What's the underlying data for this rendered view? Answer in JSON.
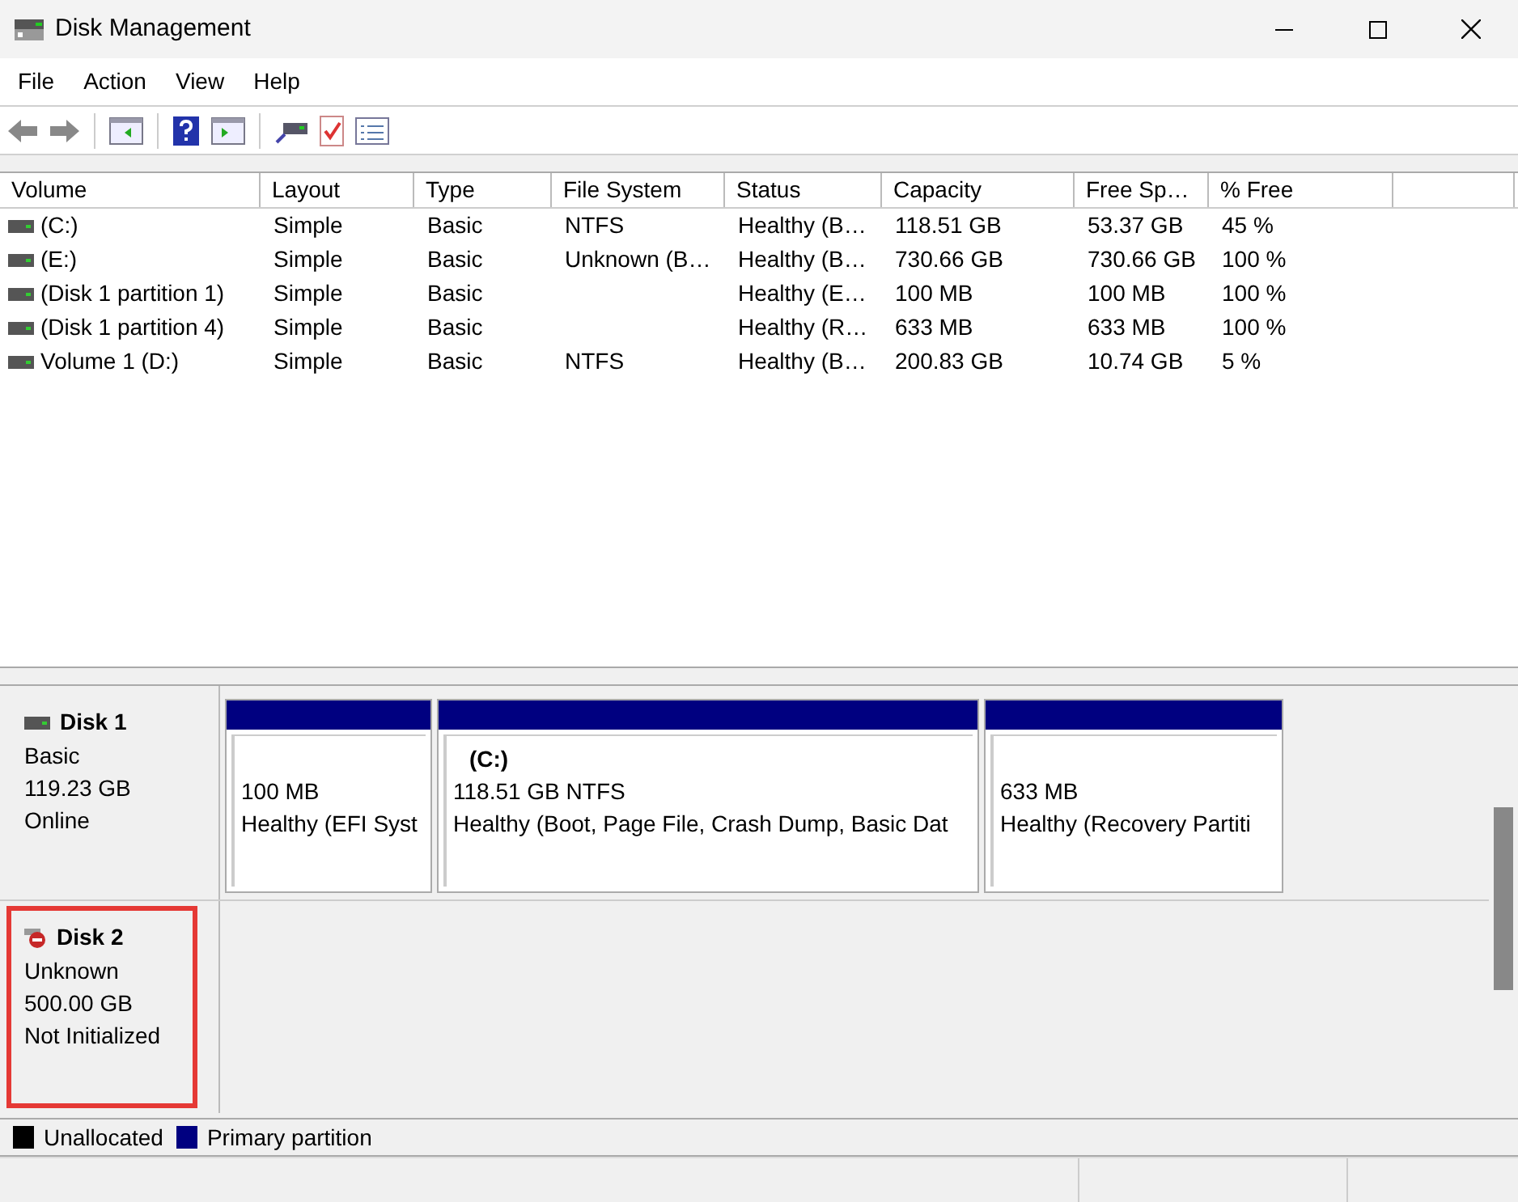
{
  "window": {
    "title": "Disk Management"
  },
  "menu": [
    "File",
    "Action",
    "View",
    "Help"
  ],
  "table": {
    "columns": [
      "Volume",
      "Layout",
      "Type",
      "File System",
      "Status",
      "Capacity",
      "Free Sp…",
      "% Free"
    ],
    "rows": [
      {
        "cells": [
          "(C:)",
          "Simple",
          "Basic",
          "NTFS",
          "Healthy (B…",
          "118.51 GB",
          "53.37 GB",
          "45 %"
        ]
      },
      {
        "cells": [
          "(E:)",
          "Simple",
          "Basic",
          "Unknown (B…",
          "Healthy (B…",
          "730.66 GB",
          "730.66 GB",
          "100 %"
        ]
      },
      {
        "cells": [
          "(Disk 1 partition 1)",
          "Simple",
          "Basic",
          "",
          "Healthy (E…",
          "100 MB",
          "100 MB",
          "100 %"
        ]
      },
      {
        "cells": [
          "(Disk 1 partition 4)",
          "Simple",
          "Basic",
          "",
          "Healthy (R…",
          "633 MB",
          "633 MB",
          "100 %"
        ]
      },
      {
        "cells": [
          "Volume 1 (D:)",
          "Simple",
          "Basic",
          "NTFS",
          "Healthy (B…",
          "200.83 GB",
          "10.74 GB",
          "5 %"
        ]
      }
    ]
  },
  "disks": [
    {
      "name": "Disk 1",
      "kind": "online",
      "highlighted": false,
      "lines": [
        "Basic",
        "119.23 GB",
        "Online"
      ],
      "partitions": [
        {
          "kind": "primary",
          "size": "100 MB",
          "status": "Healthy (EFI Syst"
        },
        {
          "kind": "primary",
          "label": "(C:)",
          "size": "118.51 GB NTFS",
          "status": "Healthy (Boot, Page File, Crash Dump, Basic Dat"
        },
        {
          "kind": "primary",
          "size": "633 MB",
          "status": "Healthy (Recovery Partiti"
        }
      ]
    },
    {
      "name": "Disk 2",
      "kind": "not_initialized",
      "highlighted": true,
      "lines": [
        "Unknown",
        "500.00 GB",
        "Not Initialized"
      ]
    }
  ],
  "legend": [
    {
      "label": "Unallocated",
      "color": "#000000"
    },
    {
      "label": "Primary partition",
      "color": "#000080"
    }
  ]
}
